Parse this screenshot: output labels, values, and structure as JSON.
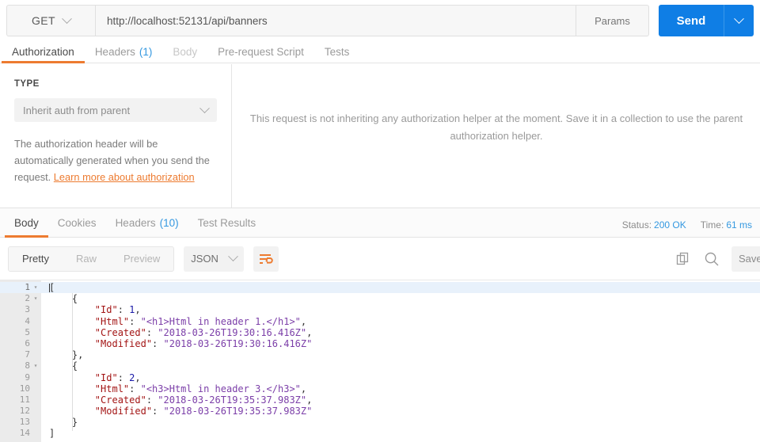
{
  "request": {
    "method": "GET",
    "url": "http://localhost:52131/api/banners",
    "params_label": "Params",
    "send_label": "Send",
    "tabs": [
      {
        "label": "Authorization",
        "count": "",
        "state": "active"
      },
      {
        "label": "Headers",
        "count": "(1)",
        "state": "normal"
      },
      {
        "label": "Body",
        "count": "",
        "state": "dim"
      },
      {
        "label": "Pre-request Script",
        "count": "",
        "state": "normal"
      },
      {
        "label": "Tests",
        "count": "",
        "state": "normal"
      }
    ]
  },
  "auth": {
    "type_label": "TYPE",
    "type_value": "Inherit auth from parent",
    "note_text": "The authorization header will be automatically generated when you send the request. ",
    "note_link": "Learn more about authorization",
    "message": "This request is not inheriting any authorization helper at the moment. Save it in a collection to use the parent authorization helper."
  },
  "response": {
    "tabs": [
      {
        "label": "Body",
        "count": "",
        "state": "active"
      },
      {
        "label": "Cookies",
        "count": "",
        "state": "normal"
      },
      {
        "label": "Headers",
        "count": "(10)",
        "state": "normal"
      },
      {
        "label": "Test Results",
        "count": "",
        "state": "normal"
      }
    ],
    "status_label": "Status:",
    "status_value": "200 OK",
    "time_label": "Time:",
    "time_value": "61 ms",
    "view_modes": [
      "Pretty",
      "Raw",
      "Preview"
    ],
    "active_view": "Pretty",
    "format": "JSON",
    "save_label": "Save Response"
  },
  "colors": {
    "accent_orange": "#ed7b30",
    "send_blue": "#0f7ee5",
    "link_blue": "#3498e0",
    "json_key": "#a31515",
    "json_string": "#7b3ea8",
    "json_number": "#1a1aa8"
  },
  "body": {
    "lines": [
      {
        "num": "1",
        "fold": "▾",
        "active": true,
        "segments": [
          {
            "t": "[",
            "c": "p"
          }
        ],
        "cursor": true
      },
      {
        "num": "2",
        "fold": "▾",
        "active": false,
        "segments": [
          {
            "t": "    {",
            "c": "p"
          }
        ]
      },
      {
        "num": "3",
        "fold": "",
        "active": false,
        "segments": [
          {
            "t": "        ",
            "c": "p"
          },
          {
            "t": "\"Id\"",
            "c": "k"
          },
          {
            "t": ": ",
            "c": "p"
          },
          {
            "t": "1",
            "c": "n"
          },
          {
            "t": ",",
            "c": "p"
          }
        ]
      },
      {
        "num": "4",
        "fold": "",
        "active": false,
        "segments": [
          {
            "t": "        ",
            "c": "p"
          },
          {
            "t": "\"Html\"",
            "c": "k"
          },
          {
            "t": ": ",
            "c": "p"
          },
          {
            "t": "\"<h1>Html in header 1.</h1>\"",
            "c": "s"
          },
          {
            "t": ",",
            "c": "p"
          }
        ]
      },
      {
        "num": "5",
        "fold": "",
        "active": false,
        "segments": [
          {
            "t": "        ",
            "c": "p"
          },
          {
            "t": "\"Created\"",
            "c": "k"
          },
          {
            "t": ": ",
            "c": "p"
          },
          {
            "t": "\"2018-03-26T19:30:16.416Z\"",
            "c": "s"
          },
          {
            "t": ",",
            "c": "p"
          }
        ]
      },
      {
        "num": "6",
        "fold": "",
        "active": false,
        "segments": [
          {
            "t": "        ",
            "c": "p"
          },
          {
            "t": "\"Modified\"",
            "c": "k"
          },
          {
            "t": ": ",
            "c": "p"
          },
          {
            "t": "\"2018-03-26T19:30:16.416Z\"",
            "c": "s"
          }
        ]
      },
      {
        "num": "7",
        "fold": "",
        "active": false,
        "segments": [
          {
            "t": "    },",
            "c": "p"
          }
        ]
      },
      {
        "num": "8",
        "fold": "▾",
        "active": false,
        "segments": [
          {
            "t": "    {",
            "c": "p"
          }
        ]
      },
      {
        "num": "9",
        "fold": "",
        "active": false,
        "segments": [
          {
            "t": "        ",
            "c": "p"
          },
          {
            "t": "\"Id\"",
            "c": "k"
          },
          {
            "t": ": ",
            "c": "p"
          },
          {
            "t": "2",
            "c": "n"
          },
          {
            "t": ",",
            "c": "p"
          }
        ]
      },
      {
        "num": "10",
        "fold": "",
        "active": false,
        "segments": [
          {
            "t": "        ",
            "c": "p"
          },
          {
            "t": "\"Html\"",
            "c": "k"
          },
          {
            "t": ": ",
            "c": "p"
          },
          {
            "t": "\"<h3>Html in header 3.</h3>\"",
            "c": "s"
          },
          {
            "t": ",",
            "c": "p"
          }
        ]
      },
      {
        "num": "11",
        "fold": "",
        "active": false,
        "segments": [
          {
            "t": "        ",
            "c": "p"
          },
          {
            "t": "\"Created\"",
            "c": "k"
          },
          {
            "t": ": ",
            "c": "p"
          },
          {
            "t": "\"2018-03-26T19:35:37.983Z\"",
            "c": "s"
          },
          {
            "t": ",",
            "c": "p"
          }
        ]
      },
      {
        "num": "12",
        "fold": "",
        "active": false,
        "segments": [
          {
            "t": "        ",
            "c": "p"
          },
          {
            "t": "\"Modified\"",
            "c": "k"
          },
          {
            "t": ": ",
            "c": "p"
          },
          {
            "t": "\"2018-03-26T19:35:37.983Z\"",
            "c": "s"
          }
        ]
      },
      {
        "num": "13",
        "fold": "",
        "active": false,
        "segments": [
          {
            "t": "    }",
            "c": "p"
          }
        ]
      },
      {
        "num": "14",
        "fold": "",
        "active": false,
        "segments": [
          {
            "t": "]",
            "c": "p"
          }
        ]
      }
    ]
  }
}
